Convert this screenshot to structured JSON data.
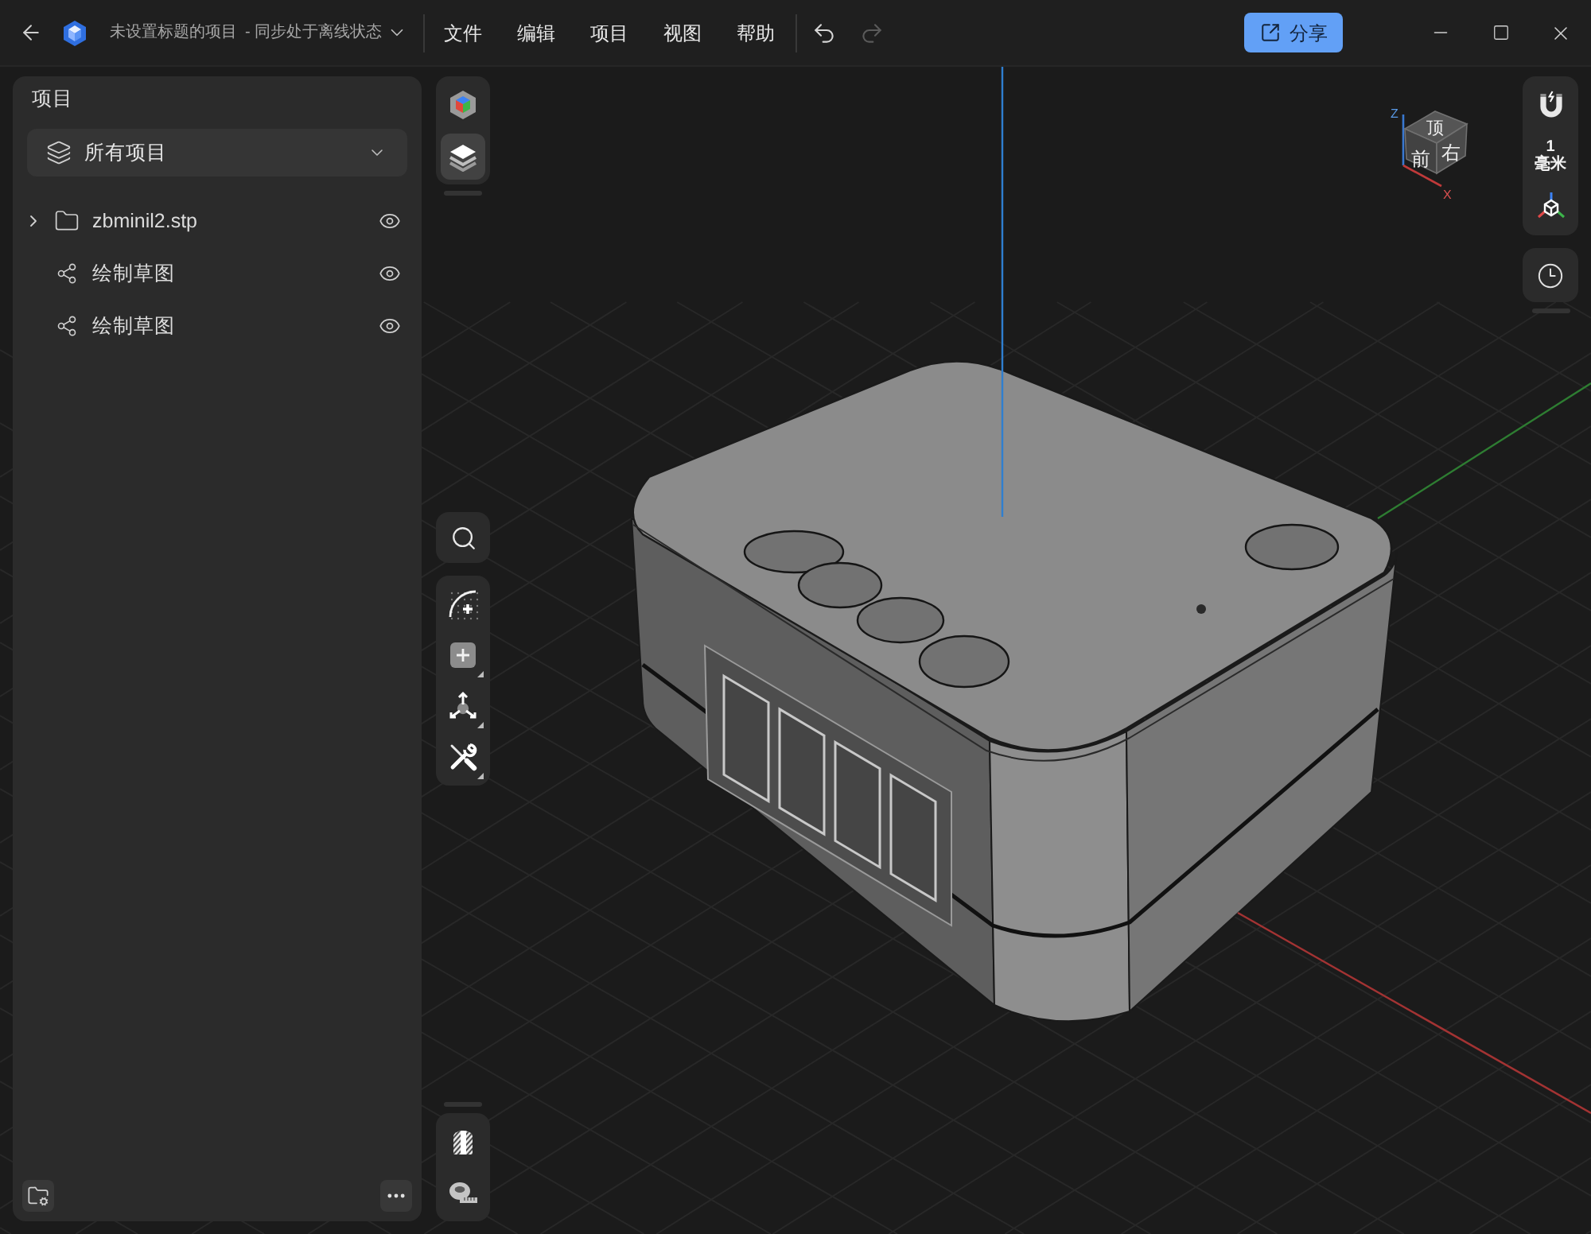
{
  "window": {
    "title": "未设置标题的项目",
    "sync_status": "- 同步处于离线状态"
  },
  "menu": [
    "文件",
    "编辑",
    "项目",
    "视图",
    "帮助"
  ],
  "history": [
    {
      "kind": "undo",
      "disabled": false
    },
    {
      "kind": "redo",
      "disabled": true
    }
  ],
  "share_button": {
    "label": "分享"
  },
  "project_panel": {
    "title": "项目",
    "filter": {
      "value": "所有项目"
    },
    "items": [
      {
        "kind": "folder",
        "label": "zbminil2.stp",
        "expanded": false,
        "visible": true
      },
      {
        "kind": "sketch",
        "label": "绘制草图",
        "visible": true
      },
      {
        "kind": "sketch",
        "label": "绘制草图",
        "visible": true
      }
    ]
  },
  "view_tools": [
    {
      "kind": "appearance",
      "selected": false
    },
    {
      "kind": "layers",
      "selected": true
    }
  ],
  "snap": {
    "value": "1",
    "unit": "毫米"
  },
  "view_cube": {
    "top": "顶",
    "front": "前",
    "right": "右",
    "axis_labels": [
      "Z",
      "X"
    ]
  }
}
